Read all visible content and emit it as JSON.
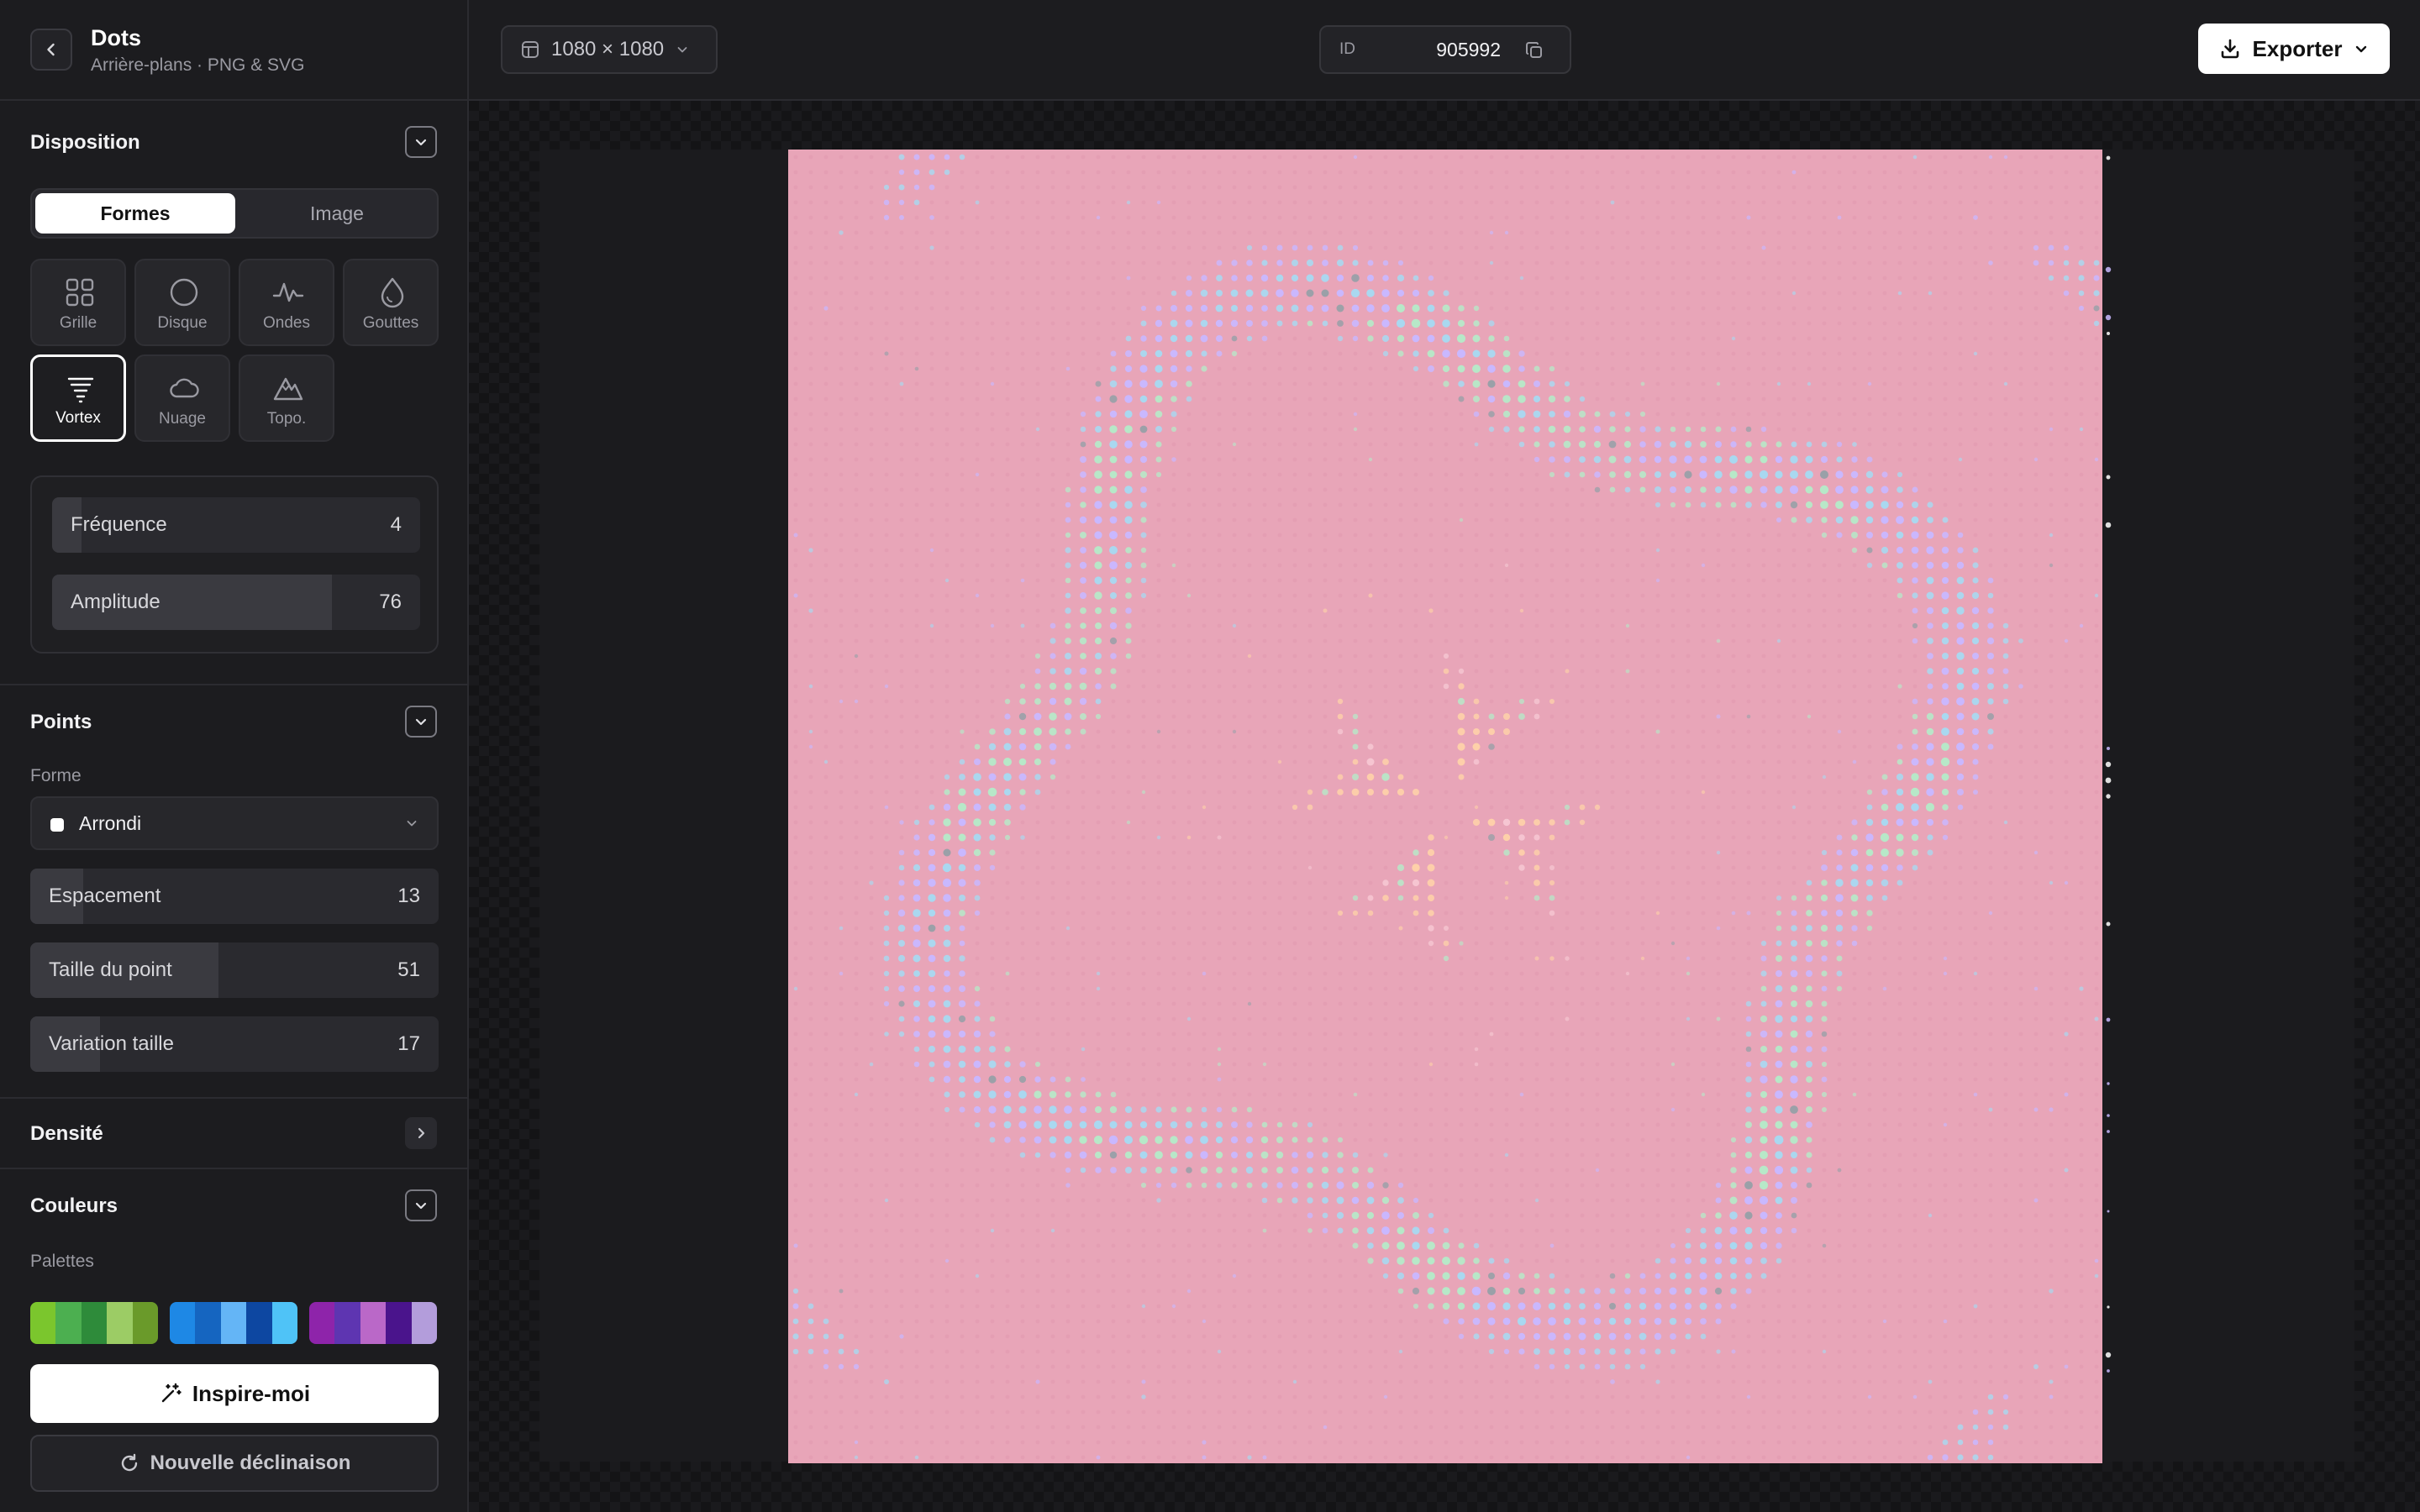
{
  "header": {
    "back_icon": "chevron-left-icon",
    "title": "Dots",
    "subtitle": "Arrière-plans · PNG & SVG"
  },
  "toolbar": {
    "size_icon": "layout-icon",
    "size_label": "1080 × 1080",
    "id_label": "ID",
    "id_value": "905992",
    "copy_icon": "copy-icon",
    "export_label": "Exporter",
    "export_icon": "download-icon"
  },
  "disposition": {
    "title": "Disposition",
    "tabs": [
      {
        "label": "Formes",
        "active": true
      },
      {
        "label": "Image",
        "active": false
      }
    ],
    "shapes": [
      {
        "label": "Grille",
        "icon": "grid-icon",
        "selected": false
      },
      {
        "label": "Disque",
        "icon": "circle-icon",
        "selected": false
      },
      {
        "label": "Ondes",
        "icon": "wave-icon",
        "selected": false
      },
      {
        "label": "Gouttes",
        "icon": "drop-icon",
        "selected": false
      },
      {
        "label": "Vortex",
        "icon": "tornado-icon",
        "selected": true
      },
      {
        "label": "Nuage",
        "icon": "cloud-icon",
        "selected": false
      },
      {
        "label": "Topo.",
        "icon": "mountain-icon",
        "selected": false
      }
    ],
    "params": [
      {
        "label": "Fréquence",
        "value": "4",
        "level": 0.08
      },
      {
        "label": "Amplitude",
        "value": "76",
        "level": 0.76
      }
    ]
  },
  "points": {
    "title": "Points",
    "shape_label": "Forme",
    "shape_value": "Arrondi",
    "sliders": [
      {
        "label": "Espacement",
        "value": "13",
        "level": 0.13
      },
      {
        "label": "Taille du point",
        "value": "51",
        "level": 0.46
      },
      {
        "label": "Variation taille",
        "value": "17",
        "level": 0.17
      }
    ]
  },
  "density": {
    "title": "Densité"
  },
  "colors": {
    "title": "Couleurs",
    "palettes_label": "Palettes",
    "palettes": [
      [
        "#7bc62d",
        "#4caf50",
        "#2e8b3a",
        "#9ccc65",
        "#6a9a2a"
      ],
      [
        "#1e88e5",
        "#1565c0",
        "#64b5f6",
        "#0d47a1",
        "#4fc3f7"
      ],
      [
        "#8e24aa",
        "#5e35b1",
        "#ba68c8",
        "#4a148c",
        "#b39ddb"
      ]
    ]
  },
  "actions": {
    "inspire_label": "Inspire-moi",
    "inspire_icon": "magic-wand-icon",
    "variation_label": "Nouvelle déclinaison",
    "variation_icon": "refresh-icon"
  },
  "artwork": {
    "background": "#e8a5b8",
    "dot_colors": [
      "#c9b8ff",
      "#a9d8f0",
      "#b7e8c8",
      "#ffd3a8",
      "#f7c9d4",
      "#9aa0a8"
    ]
  }
}
